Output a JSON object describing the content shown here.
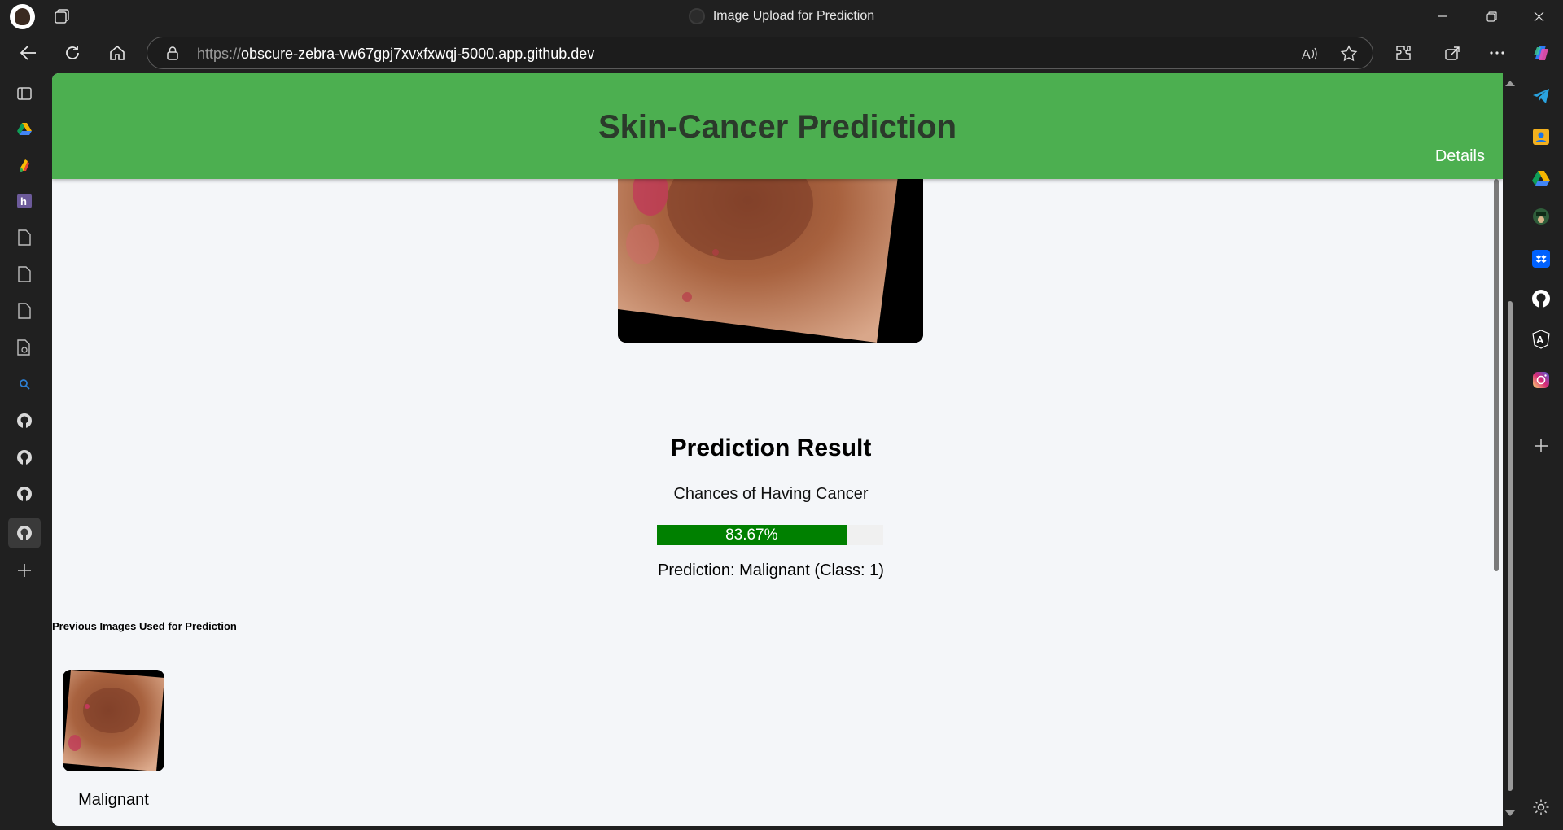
{
  "window": {
    "title": "Image Upload for Prediction",
    "controls": [
      "minimize",
      "restore",
      "close"
    ]
  },
  "address_bar": {
    "url_protocol": "https://",
    "url_host": "obscure-zebra-vw67gpj7xvxfxwqj-5000.app.github.dev"
  },
  "left_sidebar": {
    "items": [
      "tab-actions-icon",
      "google-drive-icon",
      "google-icon",
      "h-icon",
      "document-icon",
      "document-icon",
      "document-icon",
      "document-settings-icon",
      "search-icon",
      "github-icon",
      "github-icon",
      "github-icon",
      "github-icon",
      "add-icon"
    ]
  },
  "right_sidebar": {
    "items": [
      "copilot-icon",
      "telegram-icon",
      "contacts-icon",
      "google-drive-icon",
      "avatar-icon",
      "dropbox-icon",
      "github-icon",
      "angular-icon",
      "instagram-icon",
      "add-icon",
      "settings-icon"
    ]
  },
  "page": {
    "header_title": "Skin-Cancer Prediction",
    "details_link": "Details",
    "result_title": "Prediction Result",
    "chance_label": "Chances of Having Cancer",
    "probability_text": "83.67%",
    "probability_value": 83.67,
    "prediction_text": "Prediction: Malignant (Class: 1)",
    "previous_heading": "Previous Images Used for Prediction",
    "previous_images": [
      {
        "label": "Malignant"
      }
    ]
  },
  "colors": {
    "header_green": "#4caf50",
    "bar_green": "#008000",
    "page_bg": "#f4f6f9",
    "chrome_bg": "#202020"
  }
}
